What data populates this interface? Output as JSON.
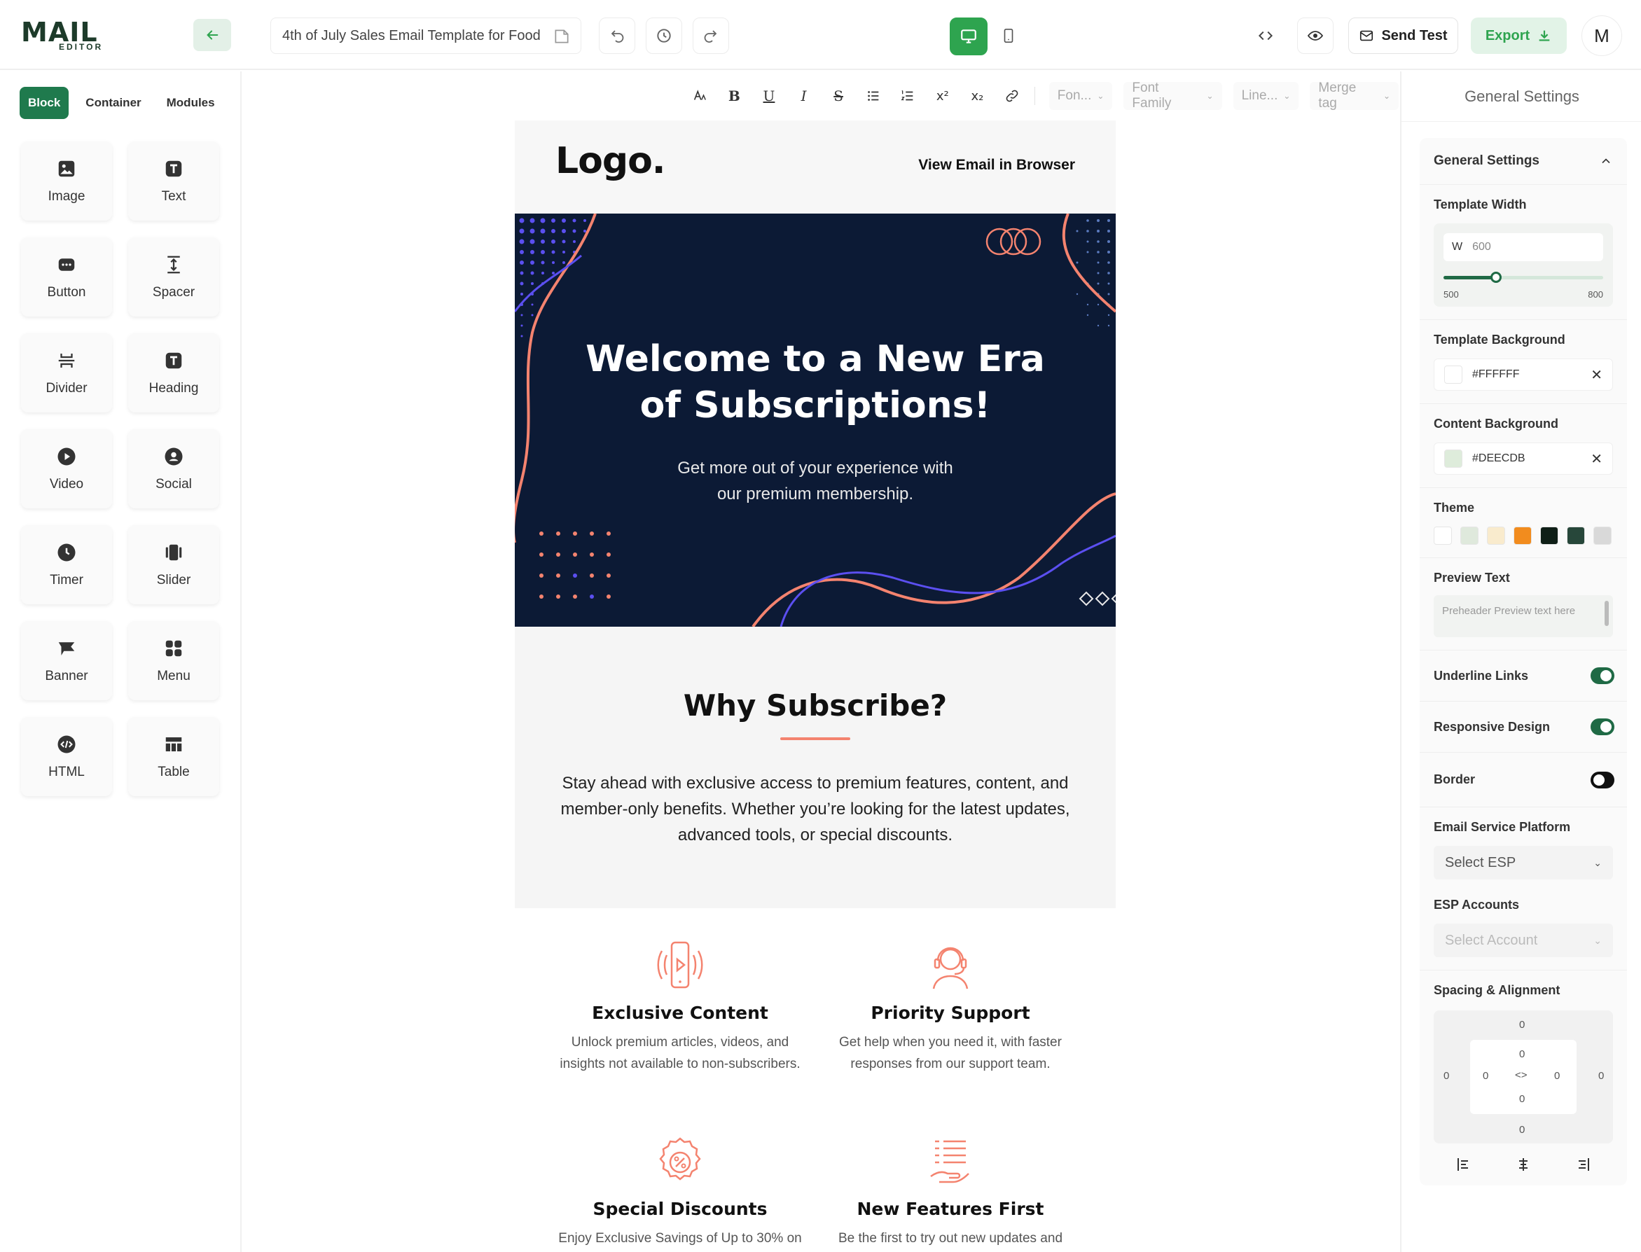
{
  "app": {
    "logo_text": "MAIL",
    "logo_sub": "EDITOR",
    "template_title": "4th of July Sales Email Template for Food",
    "send_test_label": "Send Test",
    "export_label": "Export",
    "avatar_initial": "M"
  },
  "left_panel": {
    "tabs": [
      "Block",
      "Container",
      "Modules"
    ],
    "blocks": [
      {
        "label": "Image",
        "icon": "image-icon"
      },
      {
        "label": "Text",
        "icon": "text-icon"
      },
      {
        "label": "Button",
        "icon": "button-icon"
      },
      {
        "label": "Spacer",
        "icon": "spacer-icon"
      },
      {
        "label": "Divider",
        "icon": "divider-icon"
      },
      {
        "label": "Heading",
        "icon": "heading-icon"
      },
      {
        "label": "Video",
        "icon": "video-icon"
      },
      {
        "label": "Social",
        "icon": "social-icon"
      },
      {
        "label": "Timer",
        "icon": "timer-icon"
      },
      {
        "label": "Slider",
        "icon": "slider-icon"
      },
      {
        "label": "Banner",
        "icon": "banner-icon"
      },
      {
        "label": "Menu",
        "icon": "menu-icon"
      },
      {
        "label": "HTML",
        "icon": "html-icon"
      },
      {
        "label": "Table",
        "icon": "table-icon"
      }
    ]
  },
  "format_bar": {
    "bold": "B",
    "underline": "U",
    "italic": "I",
    "strike": "S",
    "superscript": "x²",
    "subscript": "x₂",
    "font_size": "Fon...",
    "font_family": "Font Family",
    "line_height": "Line...",
    "merge_tag": "Merge tag"
  },
  "email": {
    "logo": "Logo.",
    "view_in_browser": "View Email in Browser",
    "hero_title_line1": "Welcome to a New Era",
    "hero_title_line2": "of Subscriptions!",
    "hero_sub_line1": "Get more out of your experience with",
    "hero_sub_line2": "our premium membership.",
    "why_title": "Why Subscribe?",
    "why_text": "Stay ahead with exclusive access to premium features, content, and member-only benefits. Whether you’re looking for the latest updates, advanced tools, or special discounts.",
    "features": [
      {
        "title": "Exclusive Content",
        "text": "Unlock premium articles, videos, and insights not available to non-subscribers.",
        "icon": "phone-play-icon"
      },
      {
        "title": "Priority Support",
        "text": "Get help when you need it, with faster responses from our support team.",
        "icon": "headset-support-icon"
      },
      {
        "title": "Special Discounts",
        "text": "Enjoy Exclusive Savings of Up to 30% on",
        "icon": "discount-badge-icon"
      },
      {
        "title": "New Features First",
        "text": "Be the first to try out new updates and",
        "icon": "checklist-hand-icon"
      }
    ],
    "colors": {
      "hero_bg": "#0c1a35",
      "accent": "#f4836f",
      "purple": "#5b4ff0"
    }
  },
  "right_panel": {
    "header": "General Settings",
    "section_title": "General Settings",
    "template_width_label": "Template Width",
    "width_prefix": "W",
    "width_value": "600",
    "width_min": "500",
    "width_max": "800",
    "width_slider_fraction": 0.33,
    "template_bg_label": "Template Background",
    "template_bg_value": "#FFFFFF",
    "content_bg_label": "Content Background",
    "content_bg_value": "#DEECDB",
    "theme_label": "Theme",
    "theme_colors": [
      "#ffffff",
      "#dfe9dc",
      "#f9ebcd",
      "#f28c1e",
      "#0f1f17",
      "#27473a",
      "#d9d9d9"
    ],
    "preview_text_label": "Preview Text",
    "preview_placeholder": "Preheader Preview text here",
    "underline_links_label": "Underline Links",
    "underline_links_on": true,
    "responsive_label": "Responsive Design",
    "responsive_on": true,
    "border_label": "Border",
    "border_on": false,
    "esp_label": "Email Service Platform",
    "esp_value": "Select ESP",
    "esp_accounts_label": "ESP Accounts",
    "esp_accounts_value": "Select Account",
    "spacing_label": "Spacing & Alignment",
    "spacing_values": {
      "outer_top": "0",
      "outer_left": "0",
      "outer_right": "0",
      "outer_bottom": "0",
      "inner_top": "0",
      "inner_left": "0",
      "inner_right": "0",
      "inner_bottom": "0"
    }
  }
}
